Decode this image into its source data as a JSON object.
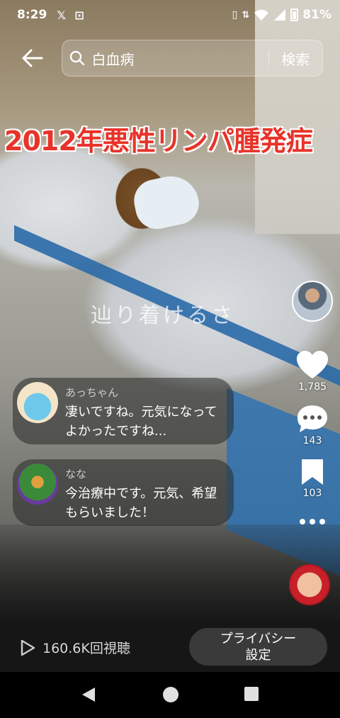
{
  "status_bar": {
    "time": "8:29",
    "battery": "81%"
  },
  "search": {
    "query": "白血病",
    "submit_label": "検索"
  },
  "video": {
    "caption": "2012年悪性リンパ腫発症",
    "subtitle": "辿り着けるさ"
  },
  "actions": {
    "likes": "1,785",
    "comments": "143",
    "bookmarks": "103"
  },
  "comments": [
    {
      "user": "あっちゃん",
      "text": "凄いですね。元気になってよかったですね..."
    },
    {
      "user": "なな",
      "text": "今治療中です。元気、希望もらいました！"
    }
  ],
  "info": {
    "views": "160.6K回視聴",
    "privacy_label": "プライバシー\n設定"
  },
  "icons": {
    "back": "arrow-left-icon",
    "search": "search-icon",
    "like": "heart-icon",
    "comment": "speech-bubble-icon",
    "bookmark": "bookmark-icon",
    "more": "more-icon",
    "views": "play-icon"
  }
}
